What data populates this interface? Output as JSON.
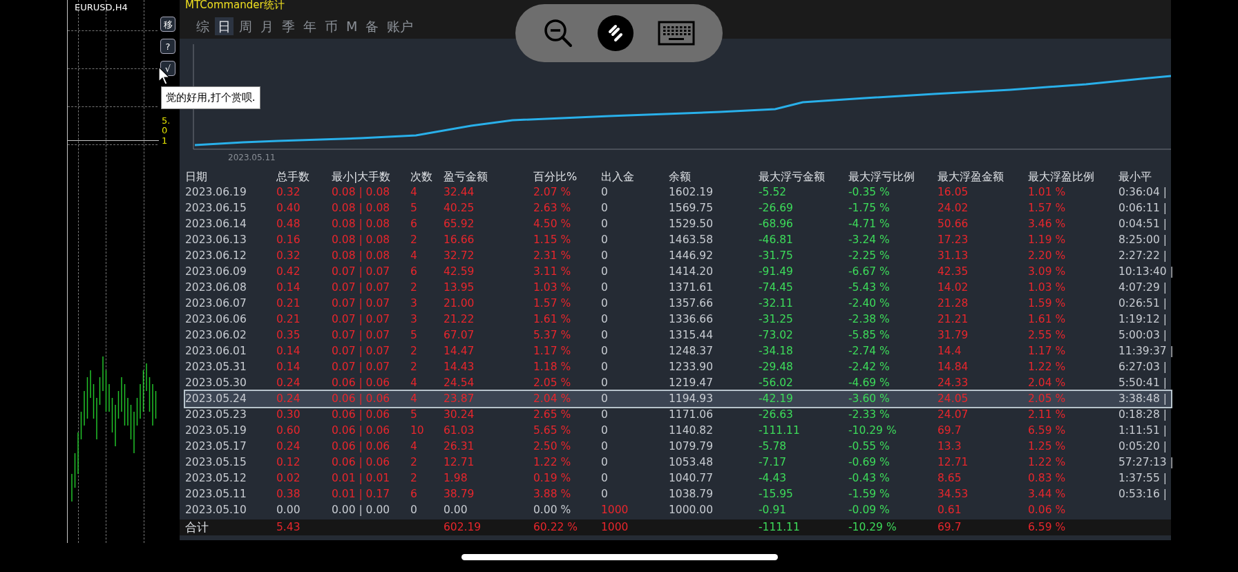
{
  "chart_window": {
    "symbol": "EURUSD,H4",
    "price_label": "5.01",
    "side_buttons": [
      "移",
      "?",
      "√"
    ],
    "tooltip": "觉的好用,打个赏呗."
  },
  "panel": {
    "title": "MTCommander统计",
    "tabs": [
      {
        "label": "综",
        "selected": false
      },
      {
        "label": "日",
        "selected": true
      },
      {
        "label": "周",
        "selected": false
      },
      {
        "label": "月",
        "selected": false
      },
      {
        "label": "季",
        "selected": false
      },
      {
        "label": "年",
        "selected": false
      },
      {
        "label": "币",
        "selected": false
      },
      {
        "label": "M",
        "selected": false
      },
      {
        "label": "备",
        "selected": false
      },
      {
        "label": "账户",
        "selected": false
      }
    ],
    "equity_chart": {
      "start_label": "2023.05.11"
    },
    "table": {
      "columns": [
        "日期",
        "总手数",
        "最小|大手数",
        "次数",
        "盈亏金额",
        "百分比%",
        "出入金",
        "余额",
        "最大浮亏金额",
        "最大浮亏比例",
        "最大浮盈金额",
        "最大浮盈比例",
        "最小平"
      ],
      "rows": [
        {
          "selected": false,
          "flat": false,
          "deposit": false,
          "cells": [
            "2023.06.19",
            "0.32",
            "0.08 | 0.08",
            "4",
            "32.44",
            "2.07 %",
            "0",
            "1602.19",
            "-5.52",
            "-0.35 %",
            "16.05",
            "1.01 %",
            "0:36:04 |"
          ]
        },
        {
          "selected": false,
          "flat": false,
          "deposit": false,
          "cells": [
            "2023.06.15",
            "0.40",
            "0.08 | 0.08",
            "5",
            "40.25",
            "2.63 %",
            "0",
            "1569.75",
            "-26.69",
            "-1.75 %",
            "24.02",
            "1.57 %",
            "0:06:11 |"
          ]
        },
        {
          "selected": false,
          "flat": false,
          "deposit": false,
          "cells": [
            "2023.06.14",
            "0.48",
            "0.08 | 0.08",
            "6",
            "65.92",
            "4.50 %",
            "0",
            "1529.50",
            "-68.96",
            "-4.71 %",
            "50.66",
            "3.46 %",
            "0:04:51 |"
          ]
        },
        {
          "selected": false,
          "flat": false,
          "deposit": false,
          "cells": [
            "2023.06.13",
            "0.16",
            "0.08 | 0.08",
            "2",
            "16.66",
            "1.15 %",
            "0",
            "1463.58",
            "-46.81",
            "-3.24 %",
            "17.23",
            "1.19 %",
            "8:25:00 |"
          ]
        },
        {
          "selected": false,
          "flat": false,
          "deposit": false,
          "cells": [
            "2023.06.12",
            "0.32",
            "0.08 | 0.08",
            "4",
            "32.72",
            "2.31 %",
            "0",
            "1446.92",
            "-31.75",
            "-2.25 %",
            "31.13",
            "2.20 %",
            "2:27:22 |"
          ]
        },
        {
          "selected": false,
          "flat": false,
          "deposit": false,
          "cells": [
            "2023.06.09",
            "0.42",
            "0.07 | 0.07",
            "6",
            "42.59",
            "3.11 %",
            "0",
            "1414.20",
            "-91.49",
            "-6.67 %",
            "42.35",
            "3.09 %",
            "10:13:40 |"
          ]
        },
        {
          "selected": false,
          "flat": false,
          "deposit": false,
          "cells": [
            "2023.06.08",
            "0.14",
            "0.07 | 0.07",
            "2",
            "13.95",
            "1.03 %",
            "0",
            "1371.61",
            "-74.45",
            "-5.43 %",
            "14.02",
            "1.03 %",
            "4:07:29 |"
          ]
        },
        {
          "selected": false,
          "flat": false,
          "deposit": false,
          "cells": [
            "2023.06.07",
            "0.21",
            "0.07 | 0.07",
            "3",
            "21.00",
            "1.57 %",
            "0",
            "1357.66",
            "-32.11",
            "-2.40 %",
            "21.28",
            "1.59 %",
            "0:26:51 |"
          ]
        },
        {
          "selected": false,
          "flat": false,
          "deposit": false,
          "cells": [
            "2023.06.06",
            "0.21",
            "0.07 | 0.07",
            "3",
            "21.22",
            "1.61 %",
            "0",
            "1336.66",
            "-31.25",
            "-2.38 %",
            "21.21",
            "1.61 %",
            "1:19:12 |"
          ]
        },
        {
          "selected": false,
          "flat": false,
          "deposit": false,
          "cells": [
            "2023.06.02",
            "0.35",
            "0.07 | 0.07",
            "5",
            "67.07",
            "5.37 %",
            "0",
            "1315.44",
            "-73.02",
            "-5.85 %",
            "31.79",
            "2.55 %",
            "5:00:03 |"
          ]
        },
        {
          "selected": false,
          "flat": false,
          "deposit": false,
          "cells": [
            "2023.06.01",
            "0.14",
            "0.07 | 0.07",
            "2",
            "14.47",
            "1.17 %",
            "0",
            "1248.37",
            "-34.18",
            "-2.74 %",
            "14.4",
            "1.17 %",
            "11:39:37 |"
          ]
        },
        {
          "selected": false,
          "flat": false,
          "deposit": false,
          "cells": [
            "2023.05.31",
            "0.14",
            "0.07 | 0.07",
            "2",
            "14.43",
            "1.18 %",
            "0",
            "1233.90",
            "-29.48",
            "-2.42 %",
            "14.84",
            "1.22 %",
            "6:27:03 |"
          ]
        },
        {
          "selected": false,
          "flat": false,
          "deposit": false,
          "cells": [
            "2023.05.30",
            "0.24",
            "0.06 | 0.06",
            "4",
            "24.54",
            "2.05 %",
            "0",
            "1219.47",
            "-56.02",
            "-4.69 %",
            "24.33",
            "2.04 %",
            "5:50:41 |"
          ]
        },
        {
          "selected": true,
          "flat": false,
          "deposit": false,
          "cells": [
            "2023.05.24",
            "0.24",
            "0.06 | 0.06",
            "4",
            "23.87",
            "2.04 %",
            "0",
            "1194.93",
            "-42.19",
            "-3.60 %",
            "24.05",
            "2.05 %",
            "3:38:48 |"
          ]
        },
        {
          "selected": false,
          "flat": false,
          "deposit": false,
          "cells": [
            "2023.05.23",
            "0.30",
            "0.06 | 0.06",
            "5",
            "30.24",
            "2.65 %",
            "0",
            "1171.06",
            "-26.63",
            "-2.33 %",
            "24.07",
            "2.11 %",
            "0:18:28 |"
          ]
        },
        {
          "selected": false,
          "flat": false,
          "deposit": false,
          "cells": [
            "2023.05.19",
            "0.60",
            "0.06 | 0.06",
            "10",
            "61.03",
            "5.65 %",
            "0",
            "1140.82",
            "-111.11",
            "-10.29 %",
            "69.7",
            "6.59 %",
            "1:11:51 |"
          ]
        },
        {
          "selected": false,
          "flat": false,
          "deposit": false,
          "cells": [
            "2023.05.17",
            "0.24",
            "0.06 | 0.06",
            "4",
            "26.31",
            "2.50 %",
            "0",
            "1079.79",
            "-5.78",
            "-0.55 %",
            "13.3",
            "1.25 %",
            "0:05:20 |"
          ]
        },
        {
          "selected": false,
          "flat": false,
          "deposit": false,
          "cells": [
            "2023.05.15",
            "0.12",
            "0.06 | 0.06",
            "2",
            "12.71",
            "1.22 %",
            "0",
            "1053.48",
            "-7.17",
            "-0.69 %",
            "12.71",
            "1.22 %",
            "57:27:13 |"
          ]
        },
        {
          "selected": false,
          "flat": false,
          "deposit": false,
          "cells": [
            "2023.05.12",
            "0.02",
            "0.01 | 0.01",
            "2",
            "1.98",
            "0.19 %",
            "0",
            "1040.77",
            "-4.43",
            "-0.43 %",
            "8.65",
            "0.83 %",
            "1:37:55 |"
          ]
        },
        {
          "selected": false,
          "flat": false,
          "deposit": false,
          "cells": [
            "2023.05.11",
            "0.38",
            "0.01 | 0.17",
            "6",
            "38.79",
            "3.88 %",
            "0",
            "1038.79",
            "-15.95",
            "-1.59 %",
            "34.53",
            "3.44 %",
            "0:53:16 |"
          ]
        },
        {
          "selected": false,
          "flat": true,
          "deposit": true,
          "cells": [
            "2023.05.10",
            "0.00",
            "0.00 | 0.00",
            "0",
            "0.00",
            "0.00 %",
            "1000",
            "1000.00",
            "-0.91",
            "-0.09 %",
            "0.61",
            "0.06 %"
          ]
        }
      ],
      "total": {
        "label": "合计",
        "lots": "5.43",
        "profit": "602.19",
        "percent": "60.22 %",
        "deposit": "1000",
        "max_loss": "-111.11",
        "max_loss_pct": "-10.29 %",
        "max_gain": "69.7",
        "max_gain_pct": "6.59 %"
      }
    }
  },
  "remote_toolbar": {
    "visible": true
  }
}
